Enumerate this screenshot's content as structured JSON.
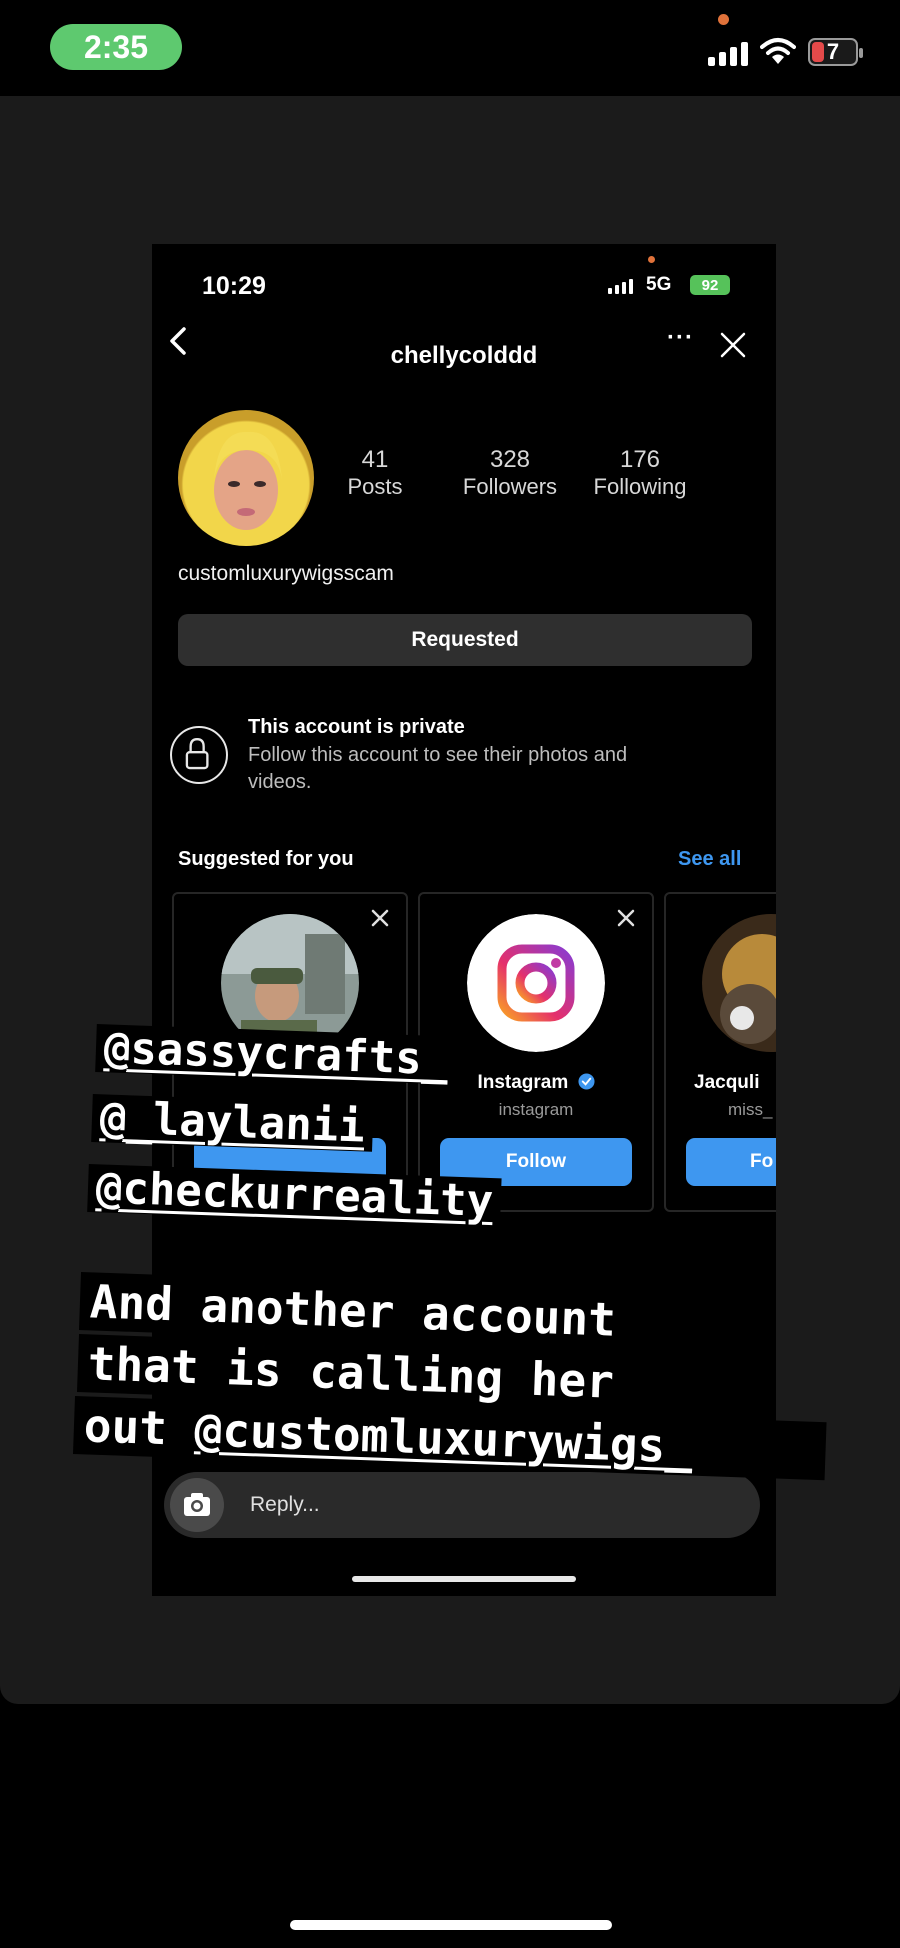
{
  "status_bar": {
    "time": "2:35",
    "battery": "7"
  },
  "screenshot": {
    "status": {
      "time": "10:29",
      "network": "5G",
      "battery": "92"
    },
    "profile": {
      "username": "chellycolddd",
      "more": "···",
      "display_name": "customluxurywigsscam",
      "stats": [
        {
          "value": "41",
          "label": "Posts"
        },
        {
          "value": "328",
          "label": "Followers"
        },
        {
          "value": "176",
          "label": "Following"
        }
      ],
      "requested_label": "Requested",
      "private_title": "This account is private",
      "private_subtitle": "Follow this account to see their photos and videos."
    },
    "suggested": {
      "title": "Suggested for you",
      "see_all": "See all",
      "cards": [
        {
          "name": "",
          "handle": "",
          "button": ""
        },
        {
          "name": "Instagram",
          "handle": "instagram",
          "button": "Follow"
        },
        {
          "name": "Jacquli",
          "handle": "miss_",
          "button": "Fo"
        }
      ]
    },
    "reply_placeholder": "Reply..."
  },
  "story_overlay": {
    "mentions": [
      "@sassycrafts_",
      "@_laylanii",
      "@checkurreality"
    ],
    "caption_lines": [
      "And another account",
      "that is calling her",
      "out"
    ],
    "caption_mention": "@customluxurywigs_"
  },
  "colors": {
    "accent_blue": "#3e97f0",
    "status_green": "#5ec96f",
    "card_background": "#1b1b1b"
  }
}
